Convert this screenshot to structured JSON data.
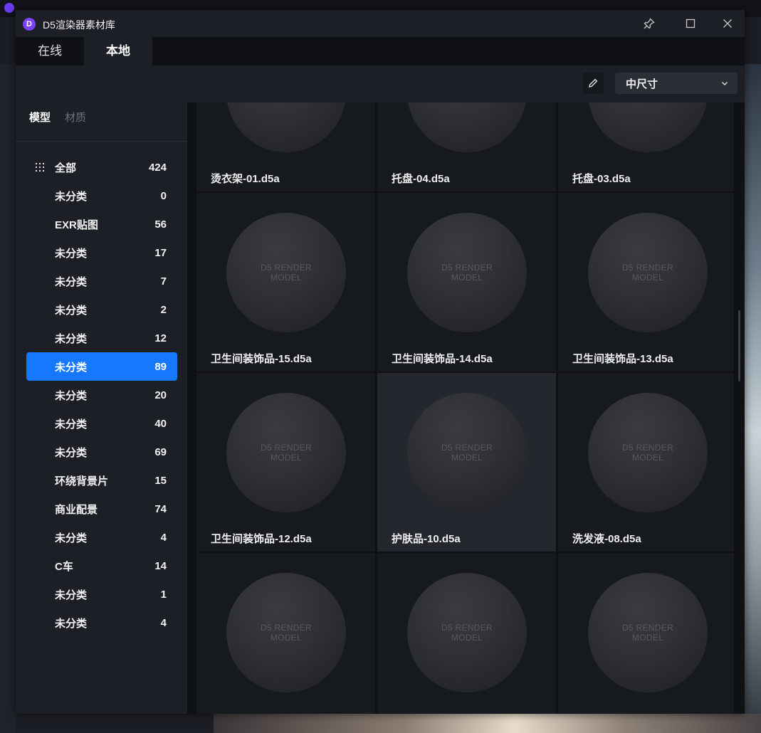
{
  "window": {
    "title": "D5渲染器素材库",
    "logo_letter": "D"
  },
  "tabs": [
    {
      "label": "在线"
    },
    {
      "label": "本地"
    }
  ],
  "toolbar": {
    "size_value": "中尺寸"
  },
  "sidebar": {
    "tabs": [
      {
        "label": "模型"
      },
      {
        "label": "材质"
      }
    ],
    "categories": [
      {
        "name": "全部",
        "count": "424"
      },
      {
        "name": "未分类",
        "count": "0"
      },
      {
        "name": "EXR贴图",
        "count": "56"
      },
      {
        "name": "未分类",
        "count": "17"
      },
      {
        "name": "未分类",
        "count": "7"
      },
      {
        "name": "未分类",
        "count": "2"
      },
      {
        "name": "未分类",
        "count": "12"
      },
      {
        "name": "未分类",
        "count": "89"
      },
      {
        "name": "未分类",
        "count": "20"
      },
      {
        "name": "未分类",
        "count": "40"
      },
      {
        "name": "未分类",
        "count": "69"
      },
      {
        "name": "环绕背景片",
        "count": "15"
      },
      {
        "name": "商业配景",
        "count": "74"
      },
      {
        "name": "未分类",
        "count": "4"
      },
      {
        "name": "C车",
        "count": "14"
      },
      {
        "name": "未分类",
        "count": "1"
      },
      {
        "name": "未分类",
        "count": "4"
      }
    ],
    "active_index": 7
  },
  "placeholder": {
    "line1": "D5 RENDER",
    "line2": "MODEL"
  },
  "items": [
    {
      "name": "烫衣架-01.d5a"
    },
    {
      "name": "托盘-04.d5a"
    },
    {
      "name": "托盘-03.d5a"
    },
    {
      "name": "卫生间装饰品-15.d5a"
    },
    {
      "name": "卫生间装饰品-14.d5a"
    },
    {
      "name": "卫生间装饰品-13.d5a"
    },
    {
      "name": "卫生间装饰品-12.d5a"
    },
    {
      "name": "护肤品-10.d5a"
    },
    {
      "name": "洗发液-08.d5a"
    },
    {
      "name": ""
    },
    {
      "name": ""
    },
    {
      "name": ""
    }
  ],
  "colors": {
    "accent": "#1677ff",
    "logo": "#7b43f5"
  }
}
